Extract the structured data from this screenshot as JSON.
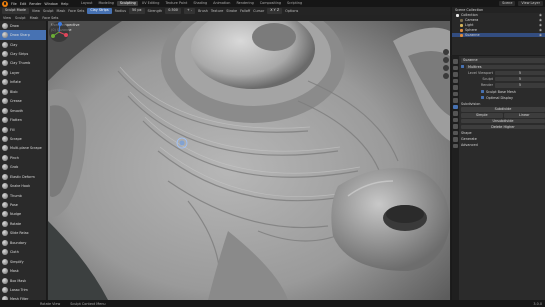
{
  "menubar": {
    "items": [
      "File",
      "Edit",
      "Render",
      "Window",
      "Help"
    ],
    "workspaces": [
      "Layout",
      "Modeling",
      "Sculpting",
      "UV Editing",
      "Texture Paint",
      "Shading",
      "Animation",
      "Rendering",
      "Compositing",
      "Scripting"
    ],
    "active_workspace": "Sculpting",
    "scene": "Scene",
    "view_layer": "View Layer"
  },
  "header": {
    "mode": "Sculpt Mode",
    "view": "View",
    "sculpt": "Sculpt",
    "mask": "Mask",
    "face_sets": "Face Sets",
    "brush": "Clay Strips",
    "radius_label": "Radius",
    "radius": "50 px",
    "strength_label": "Strength",
    "strength": "0.500",
    "direction": "+ -",
    "brush_menu": "Brush",
    "texture": "Texture",
    "stroke": "Stroke",
    "falloff": "Falloff",
    "cursor": "Cursor",
    "symmetry": "X Y Z",
    "options": "Options"
  },
  "viewport": {
    "title": "User Perspective",
    "subtitle": "(0) Suzanne"
  },
  "tools": {
    "items": [
      "Draw",
      "Draw Sharp",
      "Clay",
      "Clay Strips",
      "Clay Thumb",
      "Layer",
      "Inflate",
      "Blob",
      "Crease",
      "Smooth",
      "Flatten",
      "Fill",
      "Scrape",
      "Multi-plane Scrape",
      "Pinch",
      "Grab",
      "Elastic Deform",
      "Snake Hook",
      "Thumb",
      "Pose",
      "Nudge",
      "Rotate",
      "Slide Relax",
      "Boundary",
      "Cloth",
      "Simplify",
      "Mask",
      "Box Mask",
      "Lasso Trim",
      "Mesh Filter"
    ],
    "active_index": 1
  },
  "outliner": {
    "title": "Scene Collection",
    "rows": [
      {
        "label": "Collection",
        "color": "#e8e8e8"
      },
      {
        "label": "Camera",
        "color": "#7a6b4c"
      },
      {
        "label": "Light",
        "color": "#d3b35b"
      },
      {
        "label": "Sphere",
        "color": "#e08a3c"
      },
      {
        "label": "Suzanne",
        "color": "#e08a3c"
      }
    ],
    "selected_index": 4
  },
  "properties": {
    "object_name": "Suzanne",
    "modifier_label": "Multires",
    "modifier_type": "Multires",
    "fields": [
      {
        "label": "Level Viewport",
        "value": "5"
      },
      {
        "label": "Sculpt",
        "value": "5"
      },
      {
        "label": "Render",
        "value": "5"
      }
    ],
    "checks": [
      "Sculpt Base Mesh",
      "Optimal Display"
    ],
    "subdivision_title": "Subdivision",
    "buttons_full": [
      "Subdivide",
      "Unsubdivide",
      "Delete Higher"
    ],
    "buttons_pair": [
      "Simple",
      "Linear"
    ],
    "sections": [
      "Shape",
      "Generate",
      "Advanced"
    ]
  },
  "statusbar": {
    "left": "Rotate View",
    "middle": "Sculpt Context Menu",
    "version": "3.0.0"
  }
}
